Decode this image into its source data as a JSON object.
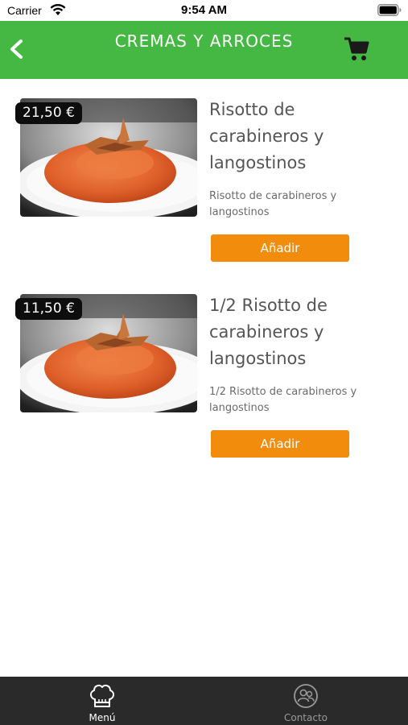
{
  "status_bar": {
    "carrier": "Carrier",
    "time": "9:54 AM"
  },
  "header": {
    "title": "CREMAS Y ARROCES",
    "back_icon": "chevron-left-icon",
    "cart_icon": "cart-icon"
  },
  "colors": {
    "header": "#45b843",
    "button": "#f28c0c",
    "tabbar": "#2a2a2a",
    "price_tag": "#0d0d0d"
  },
  "products": [
    {
      "price": "21,50 €",
      "title": "Risotto de carabineros y langostinos",
      "description": "Risotto de carabineros y langostinos",
      "button": "Añadir"
    },
    {
      "price": "11,50 €",
      "title": "1/2 Risotto de carabineros y langostinos",
      "description": "1/2 Risotto de carabineros y langostinos",
      "button": "Añadir"
    }
  ],
  "tabs": [
    {
      "label": "Menú",
      "icon": "chef-hat-icon",
      "active": true
    },
    {
      "label": "Contacto",
      "icon": "contact-icon",
      "active": false
    }
  ]
}
